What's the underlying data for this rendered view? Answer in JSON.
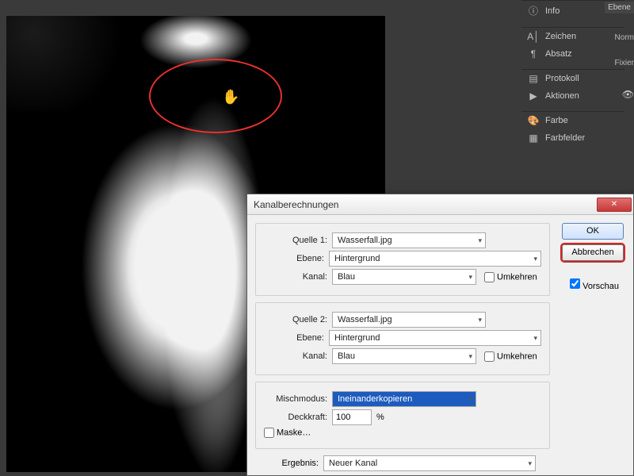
{
  "panels": {
    "info": "Info",
    "zeichen": "Zeichen",
    "absatz": "Absatz",
    "protokoll": "Protokoll",
    "aktionen": "Aktionen",
    "farbe": "Farbe",
    "farbfelder": "Farbfelder"
  },
  "layers": {
    "tab": "Ebene",
    "mode": "Norm",
    "fix": "Fixier"
  },
  "dialog": {
    "title": "Kanalberechnungen",
    "quelle1": {
      "label": "Quelle 1:",
      "value": "Wasserfall.jpg"
    },
    "ebene1": {
      "label": "Ebene:",
      "value": "Hintergrund"
    },
    "kanal1": {
      "label": "Kanal:",
      "value": "Blau",
      "invert": "Umkehren"
    },
    "quelle2": {
      "label": "Quelle 2:",
      "value": "Wasserfall.jpg"
    },
    "ebene2": {
      "label": "Ebene:",
      "value": "Hintergrund"
    },
    "kanal2": {
      "label": "Kanal:",
      "value": "Blau",
      "invert": "Umkehren"
    },
    "mischmodus": {
      "label": "Mischmodus:",
      "value": "Ineinanderkopieren"
    },
    "deckkraft": {
      "label": "Deckkraft:",
      "value": "100",
      "pct": "%"
    },
    "maske": "Maske…",
    "ergebnis": {
      "label": "Ergebnis:",
      "value": "Neuer Kanal"
    },
    "ok": "OK",
    "cancel": "Abbrechen",
    "preview": "Vorschau"
  }
}
